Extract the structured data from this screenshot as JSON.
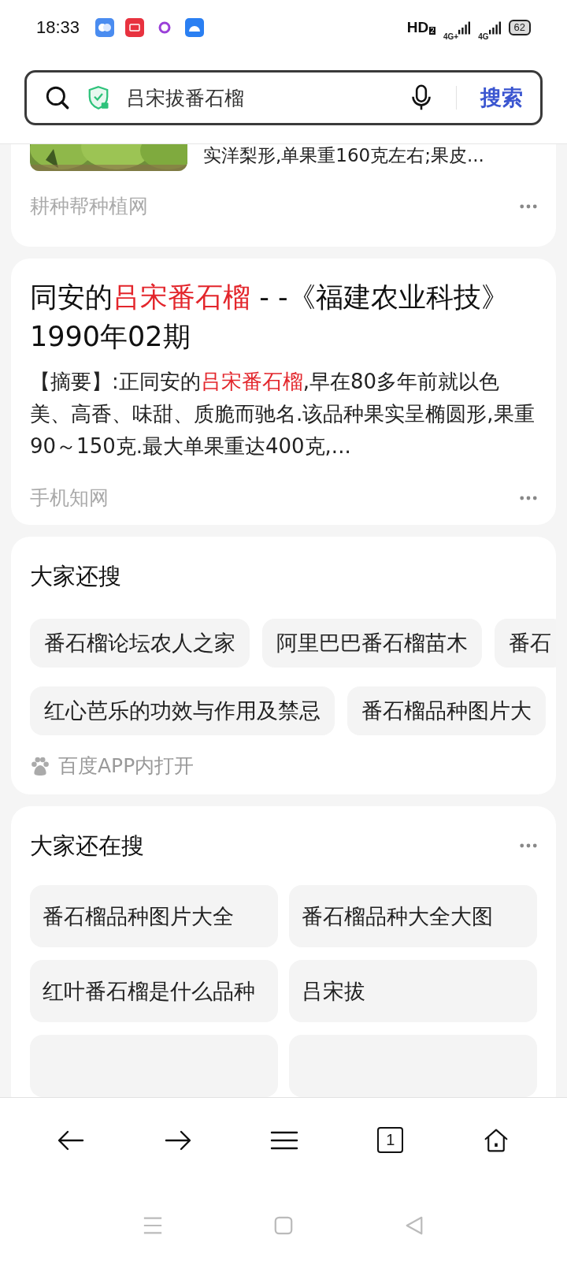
{
  "status_bar": {
    "time": "18:33",
    "hd": "HD",
    "hd_sub": "2",
    "signals": [
      "4G+",
      "4G"
    ],
    "battery": "62"
  },
  "search": {
    "query": "吕宋拔番石榴",
    "button": "搜索"
  },
  "results": [
    {
      "kind": "snippet",
      "snippet": "实洋梨形,单果重160克左右;果皮...",
      "source": "耕种帮种植网"
    },
    {
      "kind": "article",
      "title": "同安的**吕宋番石榴** - -《福建农业科技》1990年02期",
      "abstract": "【摘要】:正同安的**吕宋番石榴**,早在80多年前就以色美、高香、味甜、质脆而驰名.该品种果实呈椭圆形,果重90～150克.最大单果重达400克,...",
      "source": "手机知网"
    }
  ],
  "also_search": {
    "title": "大家还搜",
    "rows": [
      [
        "番石榴论坛农人之家",
        "阿里巴巴番石榴苗木",
        "番石"
      ],
      [
        "红心芭乐的功效与作用及禁忌",
        "番石榴品种图片大"
      ]
    ],
    "footer": "百度APP内打开"
  },
  "still_search": {
    "title": "大家还在搜",
    "items": [
      "番石榴品种图片大全",
      "番石榴品种大全大图",
      "红叶番石榴是什么品种",
      "吕宋拔"
    ]
  },
  "bottom_nav": {
    "tab_count": "1"
  }
}
